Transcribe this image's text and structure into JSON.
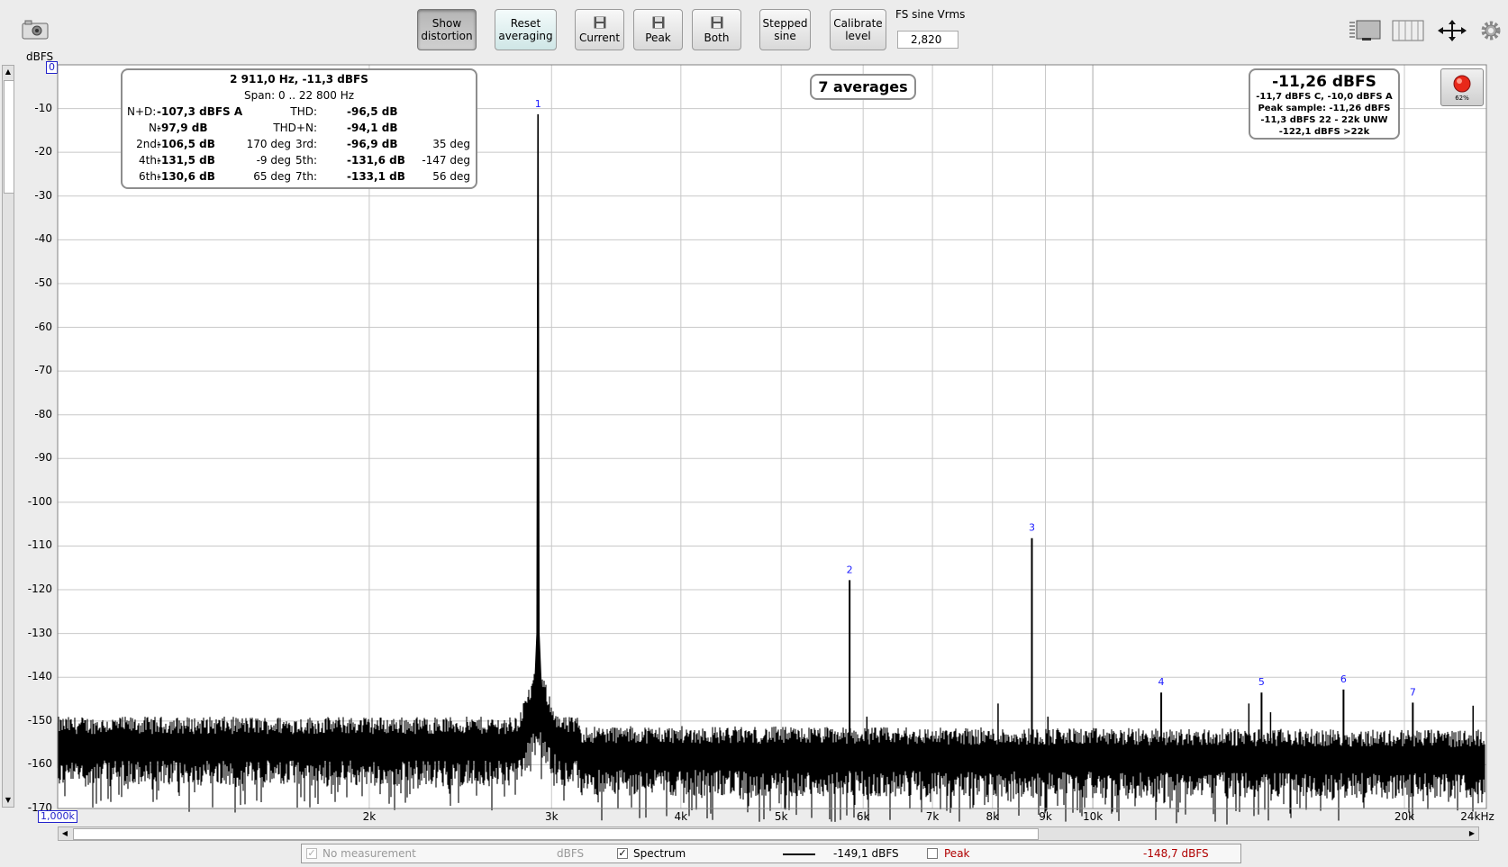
{
  "toolbar": {
    "show_distortion_1": "Show",
    "show_distortion_2": "distortion",
    "reset_averaging_1": "Reset",
    "reset_averaging_2": "averaging",
    "current_label": "Current",
    "peak_label": "Peak",
    "both_label": "Both",
    "stepped_sine_1": "Stepped",
    "stepped_sine_2": "sine",
    "calibrate_level_1": "Calibrate",
    "calibrate_level_2": "level",
    "fs_sine_label": "FS sine Vrms",
    "fs_sine_value": "2,820"
  },
  "icons": [
    "camera-icon",
    "save-icon",
    "layout-icon",
    "columns-icon",
    "move-icon",
    "gear-icon",
    "record-icon"
  ],
  "record": {
    "percent": "62%",
    "color": "#e8281a"
  },
  "distortion_box": {
    "line1": "2 911,0 Hz, -11,3 dBFS",
    "line2": "Span: 0 .. 22 800 Hz",
    "nd_label": "N+D:",
    "nd_value": "-107,3 dBFS A",
    "thd_label": "THD:",
    "thd_value": "-96,5 dB",
    "n_label": "N:",
    "n_value": "-97,9 dB",
    "thdn_label": "THD+N:",
    "thdn_value": "-94,1 dB",
    "h2_label": "2nd:",
    "h2_value": "-106,5 dB",
    "h2_phase": "170 deg",
    "h3_label": "3rd:",
    "h3_value": "-96,9 dB",
    "h3_phase": "35 deg",
    "h4_label": "4th:",
    "h4_value": "-131,5 dB",
    "h4_phase": "-9 deg",
    "h5_label": "5th:",
    "h5_value": "-131,6 dB",
    "h5_phase": "-147 deg",
    "h6_label": "6th:",
    "h6_value": "-130,6 dB",
    "h6_phase": "65 deg",
    "h7_label": "7th:",
    "h7_value": "-133,1 dB",
    "h7_phase": "56 deg"
  },
  "averages": "7 averages",
  "level_box": {
    "main": "-11,26 dBFS",
    "l1": "-11,7 dBFS C, -10,0 dBFS A",
    "l2": "Peak sample: -11,26 dBFS",
    "l3": "-11,3 dBFS 22 - 22k UNW",
    "l4": "-122,1 dBFS >22k"
  },
  "y_unit": "dBFS",
  "y_top_label": "0",
  "x_left_label": "1,000k",
  "legend": {
    "no_measurement": "No measurement",
    "no_measurement_unit": "dBFS",
    "spectrum_label": "Spectrum",
    "spectrum_value": "-149,1 dBFS",
    "peak_label": "Peak",
    "peak_value": "-148,7 dBFS",
    "peak_color": "#b00000"
  },
  "chart_data": {
    "type": "line",
    "x_scale": "log",
    "xlim": [
      1000,
      24000
    ],
    "ylim": [
      -170,
      0
    ],
    "grid": true,
    "ylabel": "dBFS",
    "yticks": [
      -10,
      -20,
      -30,
      -40,
      -50,
      -60,
      -70,
      -80,
      -90,
      -100,
      -110,
      -120,
      -130,
      -140,
      -150,
      -160,
      -170
    ],
    "xticks": [
      {
        "value": 2000,
        "label": "2k"
      },
      {
        "value": 3000,
        "label": "3k"
      },
      {
        "value": 4000,
        "label": "4k"
      },
      {
        "value": 5000,
        "label": "5k"
      },
      {
        "value": 6000,
        "label": "6k"
      },
      {
        "value": 7000,
        "label": "7k"
      },
      {
        "value": 8000,
        "label": "8k"
      },
      {
        "value": 9000,
        "label": "9k"
      },
      {
        "value": 10000,
        "label": "10k"
      },
      {
        "value": 20000,
        "label": "20k"
      },
      {
        "value": 24000,
        "label": "24kHz"
      }
    ],
    "noise_floor_db": -156,
    "series": [
      {
        "name": "Spectrum",
        "color": "#000000",
        "peaks": [
          {
            "freq": 2911,
            "db": -11.3,
            "label": "1"
          },
          {
            "freq": 5822,
            "db": -117.8,
            "label": "2"
          },
          {
            "freq": 8733,
            "db": -108.2,
            "label": "3"
          },
          {
            "freq": 11644,
            "db": -143.5,
            "label": "4"
          },
          {
            "freq": 14555,
            "db": -143.5,
            "label": "5"
          },
          {
            "freq": 17466,
            "db": -142.8,
            "label": "6"
          },
          {
            "freq": 20377,
            "db": -145.8,
            "label": "7"
          }
        ],
        "spurs": [
          {
            "freq": 6050,
            "db": -149
          },
          {
            "freq": 8100,
            "db": -146
          },
          {
            "freq": 9050,
            "db": -149
          },
          {
            "freq": 14150,
            "db": -146
          },
          {
            "freq": 14850,
            "db": -148
          },
          {
            "freq": 23300,
            "db": -146.5
          }
        ]
      }
    ]
  }
}
